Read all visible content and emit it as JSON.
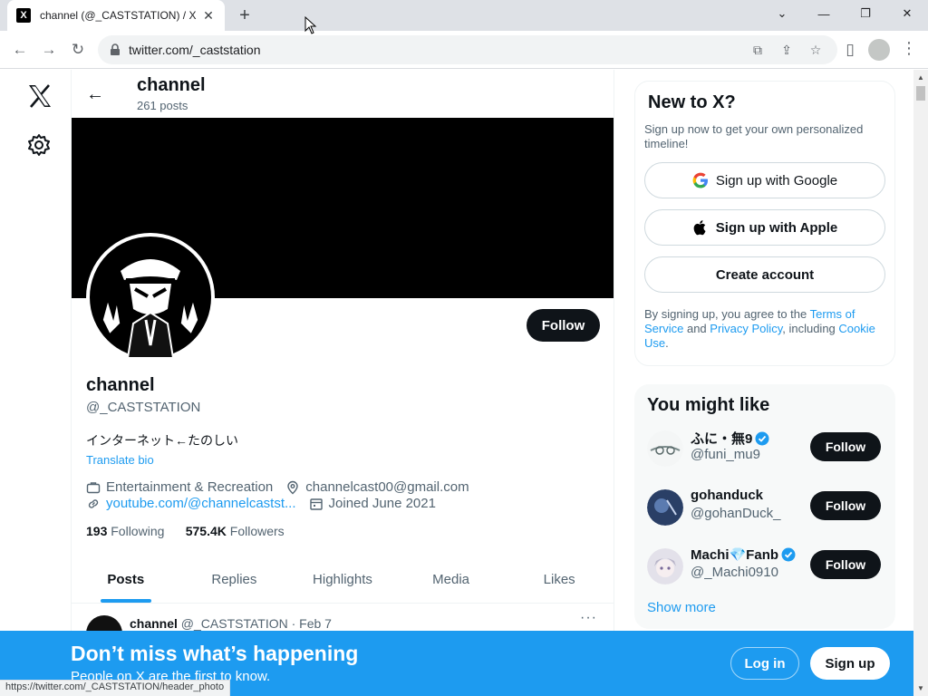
{
  "browser": {
    "tab_title": "channel (@_CASTSTATION) / X",
    "tab_favicon": "X",
    "url": "twitter.com/_caststation",
    "status_url": "https://twitter.com/_CASTSTATION/header_photo"
  },
  "profile": {
    "header_name": "channel",
    "posts_count": "261 posts",
    "display_name": "channel",
    "handle": "@_CASTSTATION",
    "bio": "インターネット←たのしい",
    "translate_label": "Translate bio",
    "category": "Entertainment & Recreation",
    "location": "channelcast00@gmail.com",
    "website": "youtube.com/@channelcastst...",
    "joined": "Joined June 2021",
    "following_count": "193",
    "following_label": "Following",
    "followers_count": "575.4K",
    "followers_label": "Followers",
    "follow_label": "Follow"
  },
  "tabs": [
    "Posts",
    "Replies",
    "Highlights",
    "Media",
    "Likes"
  ],
  "tweet": {
    "name": "channel",
    "meta": "@_CASTSTATION · Feb 7",
    "more": "···"
  },
  "signup_card": {
    "title": "New to X?",
    "subtitle": "Sign up now to get your own personalized timeline!",
    "google": "Sign up with Google",
    "apple": "Sign up with Apple",
    "create": "Create account",
    "terms_prefix": "By signing up, you agree to the ",
    "terms_link": "Terms of Service",
    "terms_and": " and ",
    "privacy_link": "Privacy Policy",
    "terms_including": ", including ",
    "cookie_link": "Cookie Use",
    "terms_end": "."
  },
  "suggestions": {
    "title": "You might like",
    "users": [
      {
        "name": "ふに・無9",
        "handle": "@funi_mu9",
        "verified": true,
        "follow": "Follow"
      },
      {
        "name": "gohanduck",
        "handle": "@gohanDuck_",
        "verified": false,
        "follow": "Follow"
      },
      {
        "name": "Machi💎Fanb",
        "handle": "@_Machi0910",
        "verified": true,
        "follow": "Follow"
      }
    ],
    "show_more": "Show more"
  },
  "bottom_bar": {
    "title": "Don’t miss what’s happening",
    "subtitle": "People on X are the first to know.",
    "login": "Log in",
    "signup": "Sign up"
  },
  "colors": {
    "accent": "#1d9bf0",
    "text": "#0f1419",
    "muted": "#536471"
  }
}
